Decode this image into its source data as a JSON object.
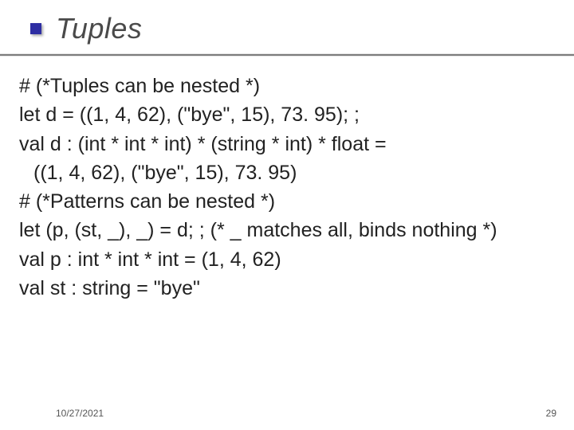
{
  "slide": {
    "title": "Tuples"
  },
  "content": {
    "l1": "#  (*Tuples can be nested *)",
    "l2": "let d = ((1, 4, 62), (\"bye\", 15), 73. 95); ;",
    "l3": "val d : (int * int * int) * (string * int) * float =",
    "l4": "((1, 4, 62), (\"bye\", 15), 73. 95)",
    "l5": "#  (*Patterns can be nested *)",
    "l6": "let (p, (st, _), _) = d; ; (* _ matches all, binds nothing *)",
    "l7": "val p : int * int * int = (1, 4, 62)",
    "l8": "val st : string = \"bye\""
  },
  "footer": {
    "date": "10/27/2021",
    "page": "29"
  }
}
